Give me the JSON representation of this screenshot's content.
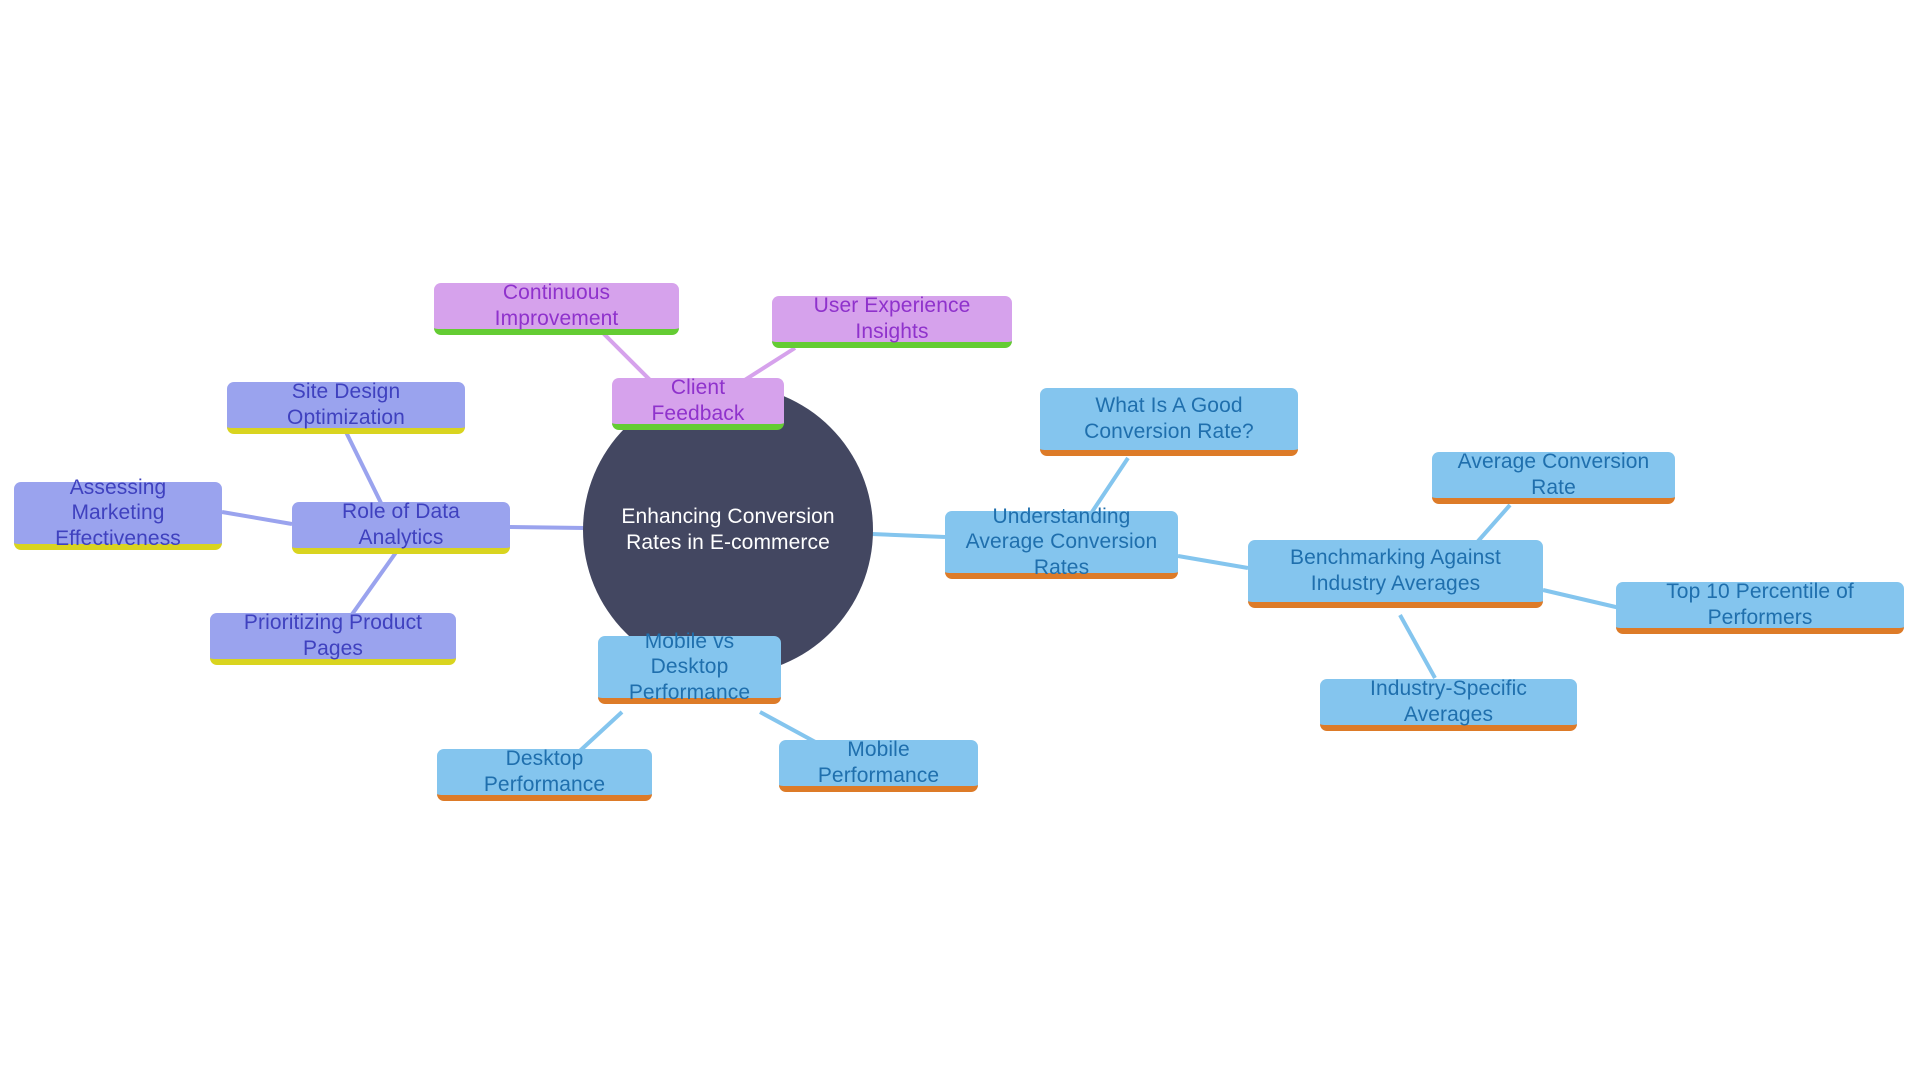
{
  "diagram": {
    "type": "mindmap",
    "title": "Enhancing Conversion Rates in E-commerce",
    "background_color": "#ffffff",
    "palette": {
      "root_fill": "#434761",
      "root_text": "#ffffff",
      "blue_fill": "#84c5ee",
      "blue_text": "#1f6fad",
      "blue_underline": "#dd7b28",
      "periwinkle_fill": "#9aa3ee",
      "periwinkle_text": "#3f41bf",
      "periwinkle_underline": "#d9d41f",
      "orchid_fill": "#d6a2ec",
      "orchid_text": "#8f32cc",
      "orchid_underline": "#64cc33"
    },
    "root": {
      "id": "root",
      "label": "Enhancing Conversion Rates in E-commerce"
    },
    "nodes": [
      {
        "id": "n_understanding",
        "label": "Understanding Average Conversion Rates",
        "group": "blue"
      },
      {
        "id": "n_goodrate",
        "label": "What Is A Good Conversion Rate?",
        "group": "blue"
      },
      {
        "id": "n_benchmarking",
        "label": "Benchmarking Against Industry Averages",
        "group": "blue"
      },
      {
        "id": "n_avgrate",
        "label": "Average Conversion Rate",
        "group": "blue"
      },
      {
        "id": "n_top10",
        "label": "Top 10 Percentile of Performers",
        "group": "blue"
      },
      {
        "id": "n_industry",
        "label": "Industry-Specific Averages",
        "group": "blue"
      },
      {
        "id": "n_mobiledesktop",
        "label": "Mobile vs Desktop Performance",
        "group": "blue"
      },
      {
        "id": "n_desktop",
        "label": "Desktop Performance",
        "group": "blue"
      },
      {
        "id": "n_mobile",
        "label": "Mobile Performance",
        "group": "blue"
      },
      {
        "id": "n_dataanalytics",
        "label": "Role of Data Analytics",
        "group": "periwinkle"
      },
      {
        "id": "n_assessing",
        "label": "Assessing Marketing Effectiveness",
        "group": "periwinkle"
      },
      {
        "id": "n_sitedesign",
        "label": "Site Design Optimization",
        "group": "periwinkle"
      },
      {
        "id": "n_prioritizing",
        "label": "Prioritizing Product Pages",
        "group": "periwinkle"
      },
      {
        "id": "n_clientfeedback",
        "label": "Client Feedback",
        "group": "orchid"
      },
      {
        "id": "n_continuous",
        "label": "Continuous Improvement",
        "group": "orchid"
      },
      {
        "id": "n_userexp",
        "label": "User Experience Insights",
        "group": "orchid"
      }
    ],
    "edges": [
      {
        "from": "root",
        "to": "n_understanding"
      },
      {
        "from": "n_understanding",
        "to": "n_goodrate"
      },
      {
        "from": "n_understanding",
        "to": "n_benchmarking"
      },
      {
        "from": "n_benchmarking",
        "to": "n_avgrate"
      },
      {
        "from": "n_benchmarking",
        "to": "n_top10"
      },
      {
        "from": "n_benchmarking",
        "to": "n_industry"
      },
      {
        "from": "root",
        "to": "n_mobiledesktop"
      },
      {
        "from": "n_mobiledesktop",
        "to": "n_desktop"
      },
      {
        "from": "n_mobiledesktop",
        "to": "n_mobile"
      },
      {
        "from": "root",
        "to": "n_dataanalytics"
      },
      {
        "from": "n_dataanalytics",
        "to": "n_assessing"
      },
      {
        "from": "n_dataanalytics",
        "to": "n_sitedesign"
      },
      {
        "from": "n_dataanalytics",
        "to": "n_prioritizing"
      },
      {
        "from": "root",
        "to": "n_clientfeedback"
      },
      {
        "from": "n_clientfeedback",
        "to": "n_continuous"
      },
      {
        "from": "n_clientfeedback",
        "to": "n_userexp"
      }
    ]
  }
}
